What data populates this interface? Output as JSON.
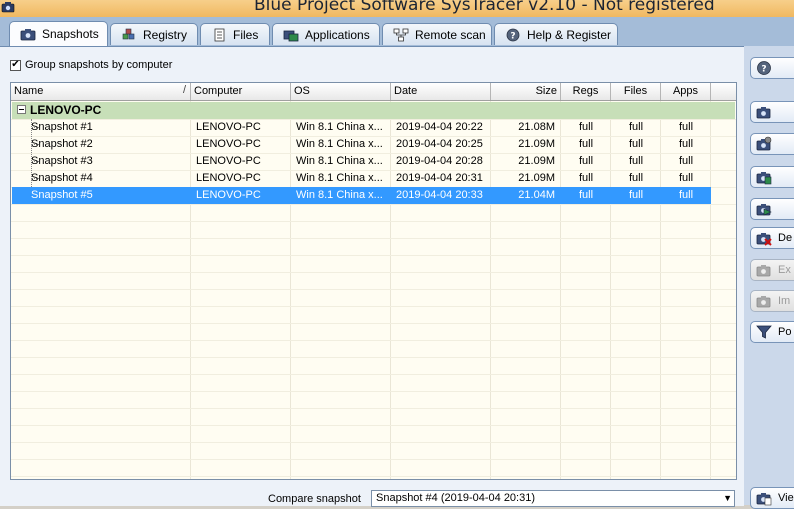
{
  "window": {
    "title": "Blue Project Software SysTracer v2.10 - Not registered"
  },
  "tabs": [
    {
      "label": "Snapshots",
      "icon": "camera-icon",
      "active": true
    },
    {
      "label": "Registry",
      "icon": "registry-cubes-icon",
      "active": false
    },
    {
      "label": "Files",
      "icon": "file-document-icon",
      "active": false
    },
    {
      "label": "Applications",
      "icon": "applications-icon",
      "active": false
    },
    {
      "label": "Remote scan",
      "icon": "network-icon",
      "active": false
    },
    {
      "label": "Help & Register",
      "icon": "help-question-icon",
      "active": false
    }
  ],
  "options": {
    "group_by_computer_label": "Group snapshots by computer",
    "group_by_computer_checked": true
  },
  "table": {
    "columns": [
      "Name",
      "Computer",
      "OS",
      "Date",
      "Size",
      "Regs",
      "Files",
      "Apps"
    ],
    "group": "LENOVO-PC",
    "rows": [
      {
        "name": "Snapshot #1",
        "computer": "LENOVO-PC",
        "os": "Win 8.1 China x...",
        "date": "2019-04-04 20:22",
        "size": "21.08M",
        "regs": "full",
        "files": "full",
        "apps": "full"
      },
      {
        "name": "Snapshot #2",
        "computer": "LENOVO-PC",
        "os": "Win 8.1 China x...",
        "date": "2019-04-04 20:25",
        "size": "21.09M",
        "regs": "full",
        "files": "full",
        "apps": "full"
      },
      {
        "name": "Snapshot #3",
        "computer": "LENOVO-PC",
        "os": "Win 8.1 China x...",
        "date": "2019-04-04 20:28",
        "size": "21.09M",
        "regs": "full",
        "files": "full",
        "apps": "full"
      },
      {
        "name": "Snapshot #4",
        "computer": "LENOVO-PC",
        "os": "Win 8.1 China x...",
        "date": "2019-04-04 20:31",
        "size": "21.09M",
        "regs": "full",
        "files": "full",
        "apps": "full"
      },
      {
        "name": "Snapshot #5",
        "computer": "LENOVO-PC",
        "os": "Win 8.1 China x...",
        "date": "2019-04-04 20:33",
        "size": "21.04M",
        "regs": "full",
        "files": "full",
        "apps": "full",
        "selected": true
      }
    ]
  },
  "side_buttons": [
    {
      "label": "",
      "icon": "help-icon",
      "enabled": true
    },
    {
      "label": "",
      "icon": "take-snapshot-camera-icon",
      "enabled": true
    },
    {
      "label": "",
      "icon": "camera-settings-icon",
      "enabled": true
    },
    {
      "label": "",
      "icon": "camera-copy-icon",
      "enabled": true
    },
    {
      "label": "",
      "icon": "camera-export-icon",
      "enabled": true
    },
    {
      "label": "De",
      "icon": "camera-delete-icon",
      "enabled": true
    },
    {
      "label": "Ex",
      "icon": "camera-export-disabled-icon",
      "enabled": false
    },
    {
      "label": "Im",
      "icon": "camera-import-disabled-icon",
      "enabled": false
    },
    {
      "label": "Po",
      "icon": "filter-funnel-icon",
      "enabled": true
    },
    {
      "label": "Vie",
      "icon": "view-compare-icon",
      "enabled": true
    }
  ],
  "compare": {
    "label": "Compare snapshot",
    "selected": "Snapshot #4 (2019-04-04 20:31)"
  },
  "colors": {
    "selection": "#3399ff",
    "group_row": "#c7dfb8",
    "list_bg": "#fffdf2",
    "titlebar": "#f0b860"
  }
}
